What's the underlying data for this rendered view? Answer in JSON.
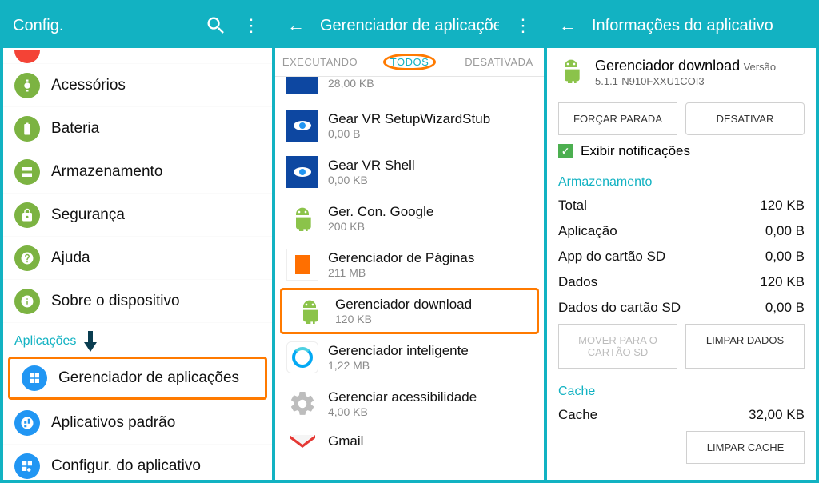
{
  "panel1": {
    "title": "Config.",
    "items": [
      {
        "label": "Acessórios"
      },
      {
        "label": "Bateria"
      },
      {
        "label": "Armazenamento"
      },
      {
        "label": "Segurança"
      },
      {
        "label": "Ajuda"
      },
      {
        "label": "Sobre o dispositivo"
      }
    ],
    "section": "Aplicações",
    "apps_items": [
      {
        "label": "Gerenciador de aplicações"
      },
      {
        "label": "Aplicativos padrão"
      },
      {
        "label": "Configur. do aplicativo"
      }
    ]
  },
  "panel2": {
    "title": "Gerenciador de aplicações",
    "tabs": {
      "t1": "EXECUTANDO",
      "t2": "TODOS",
      "t3": "DESATIVADA"
    },
    "apps": [
      {
        "name": "",
        "size": "28,00 KB"
      },
      {
        "name": "Gear VR SetupWizardStub",
        "size": "0,00 B"
      },
      {
        "name": "Gear VR Shell",
        "size": "0,00 KB"
      },
      {
        "name": "Ger. Con. Google",
        "size": "200 KB"
      },
      {
        "name": "Gerenciador de Páginas",
        "size": "211 MB"
      },
      {
        "name": "Gerenciador download",
        "size": "120 KB"
      },
      {
        "name": "Gerenciador inteligente",
        "size": "1,22 MB"
      },
      {
        "name": "Gerenciar acessibilidade",
        "size": "4,00 KB"
      },
      {
        "name": "Gmail",
        "size": ""
      }
    ]
  },
  "panel3": {
    "title": "Informações do aplicativo",
    "app_name": "Gerenciador download",
    "version": "Versão 5.1.1-N910FXXU1COI3",
    "btn_force": "FORÇAR PARADA",
    "btn_disable": "DESATIVAR",
    "chk_notif": "Exibir notificações",
    "sect_storage": "Armazenamento",
    "storage": [
      {
        "k": "Total",
        "v": "120 KB"
      },
      {
        "k": "Aplicação",
        "v": "0,00 B"
      },
      {
        "k": "App do cartão SD",
        "v": "0,00 B"
      },
      {
        "k": "Dados",
        "v": "120 KB"
      },
      {
        "k": "Dados do cartão SD",
        "v": "0,00 B"
      }
    ],
    "btn_move": "MOVER PARA O CARTÃO SD",
    "btn_clear": "LIMPAR DADOS",
    "sect_cache": "Cache",
    "cache_k": "Cache",
    "cache_v": "32,00 KB",
    "btn_clear_cache": "LIMPAR CACHE"
  }
}
